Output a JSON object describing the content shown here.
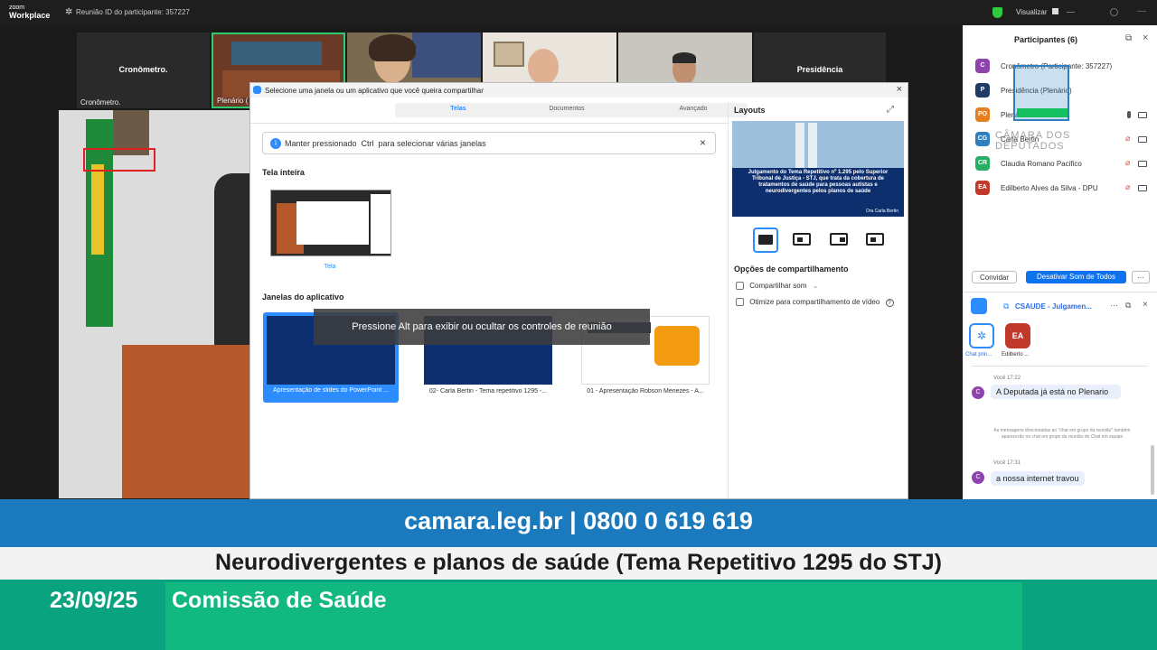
{
  "topbar": {
    "logo_line1": "zoom",
    "logo_line2": "Workplace",
    "meeting_id": "Reunião ID do participante: 357227",
    "view_label": "Visualizar"
  },
  "tiles": [
    {
      "name": "Cronômetro.",
      "center": "Cronômetro."
    },
    {
      "name": "Plenário ("
    },
    {
      "name": ""
    },
    {
      "name": ""
    },
    {
      "name": ""
    },
    {
      "center": "Presidência"
    }
  ],
  "dialog": {
    "title": "Selecione uma janela ou um aplicativo que você queira compartilhar",
    "tabs": [
      "Telas",
      "Documentos",
      "Avançado"
    ],
    "info": "Manter pressionado  Ctrl  para selecionar várias janelas",
    "section_full": "Tela inteira",
    "full_screen_label": "Tela",
    "section_apps": "Janelas do aplicativo",
    "apps": [
      "Apresentação de slides do PowerPoint ...",
      "02- Carla Bertin - Tema repetitivo 1295 -...",
      "01 - Apresentação Robson Menezes - A..."
    ],
    "tooltip": "Pressione Alt para exibir ou ocultar os controles de reunião",
    "layouts_title": "Layouts",
    "preview_title": "Julgamento do Tema Repetitivo nº 1.295 pelo Superior Tribunal de Justiça - STJ, que trata da cobertura de tratamentos de saúde para pessoas autistas e neurodivergentes pelos planos de saúde",
    "preview_author": "Dra Carla Bertin",
    "options_title": "Opções de compartilhamento",
    "opt1": "Compartilhar som",
    "opt2": "Otimize para compartilhamento de vídeo"
  },
  "participants": {
    "header": "Participantes (6)",
    "list": [
      {
        "initials": "C",
        "name": "Cronômetro (Participante: 357227)",
        "color": "#8e44ad"
      },
      {
        "initials": "P",
        "name": "Presidência (Plenário)",
        "color": "#1f3b63"
      },
      {
        "initials": "PO",
        "name": "Plenário",
        "color": "#e67e22"
      },
      {
        "initials": "CG",
        "name": "Carla Bertin",
        "color": "#2f80c0"
      },
      {
        "initials": "CR",
        "name": "Claudia Romano Pacifico",
        "color": "#27ae60"
      },
      {
        "initials": "EA",
        "name": "Edilberto Alves da Silva - DPU",
        "color": "#c0392b"
      }
    ],
    "invite": "Convidar",
    "mute_all": "Desativar Som de Todos",
    "logo_text": "CÂMARA DOS DEPUTADOS"
  },
  "chat": {
    "header": "CSAUDE - Julgamen...",
    "av1_label": "Chat prin...",
    "av2_label": "Edilberto ...",
    "time1": "Você 17:22",
    "msg1": "A Deputada já está no Plenario",
    "system": "As mensagens direcionadas ao \"chat em grupo da reunião\" também aparecerão no chat em grupo da reunião do Chat em equipe",
    "time2": "Você 17:31",
    "msg2": "a nossa internet travou"
  },
  "banner": {
    "contact": "camara.leg.br | 0800 0 619 619",
    "topic": "Neurodivergentes e planos de saúde (Tema Repetitivo 1295 do STJ)",
    "date": "23/09/25",
    "committee": "Comissão de Saúde"
  }
}
